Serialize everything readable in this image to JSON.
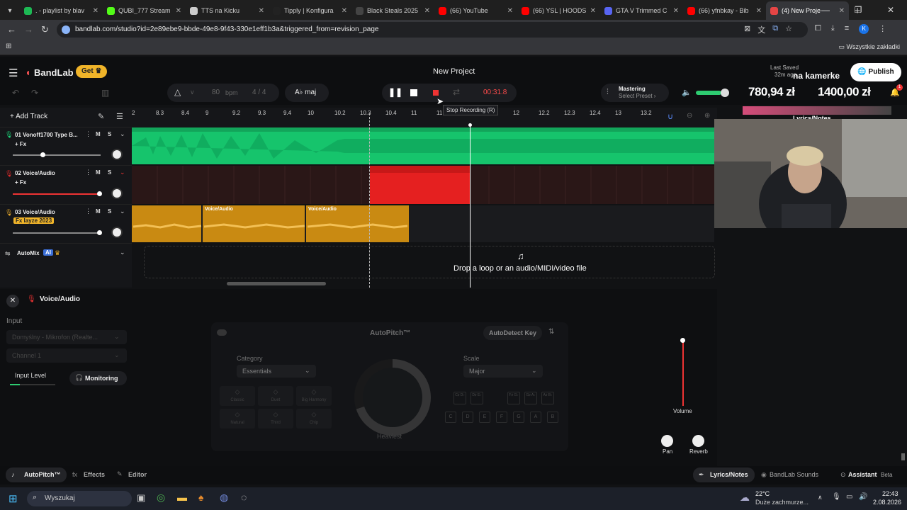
{
  "browser": {
    "tabs": [
      {
        "title": ". - playlist by blav",
        "fav": "#1db954"
      },
      {
        "title": "QUBI_777 Stream",
        "fav": "#53fc18"
      },
      {
        "title": "TTS na Kicku",
        "fav": "#cccccc"
      },
      {
        "title": "Tipply | Konfigura",
        "fav": "#222222"
      },
      {
        "title": "Black Steals 2025",
        "fav": "#444444"
      },
      {
        "title": "(66) YouTube",
        "fav": "#ff0000"
      },
      {
        "title": "(66) YSL | HOODS",
        "fav": "#ff0000"
      },
      {
        "title": "GTA V Trimmed C",
        "fav": "#5865f2"
      },
      {
        "title": "(66) yfnbkay - Bib",
        "fav": "#ff0000"
      },
      {
        "title": "(4) New Proje",
        "fav": "#e54545",
        "active": true
      }
    ],
    "url": "bandlab.com/studio?id=2e89ebe9-bbde-49e8-9f43-330e1eff1b3a&triggered_from=revision_page",
    "bookmarks_label": "Wszystkie zakładki"
  },
  "app": {
    "brand": "BandLab",
    "get_label": "Get",
    "project_title": "New Project",
    "last_saved": "Last Saved",
    "saved_ago": "32m ago",
    "publish_label": "Publish",
    "overlay_kamerke": "na kamerke",
    "overlay_money1": "780,94 zł",
    "overlay_money2": "1400,00 zł",
    "lyrics_notes_top": "Lyrics/Notes"
  },
  "toolbar": {
    "bpm_value": "80",
    "bpm_label": "bpm",
    "time_sig": "4 / 4",
    "key": "A♭ maj",
    "time": "00:31.8",
    "tooltip": "Stop Recording (R)",
    "mastering_label": "Mastering",
    "mastering_preset": "Select Preset"
  },
  "tracks_header": {
    "add_track": "Add Track"
  },
  "ruler_ticks": [
    "2",
    "8.3",
    "8.4",
    "9",
    "9.2",
    "9.3",
    "9.4",
    "10",
    "10.2",
    "10.3",
    "10.4",
    "11",
    "11",
    "",
    "12",
    "12.2",
    "12.3",
    "12.4",
    "13",
    "13.2"
  ],
  "tracks": [
    {
      "num": "01",
      "name": "Vonoff1700 Type B...",
      "fx": "+ Fx",
      "mute": "M",
      "solo": "S",
      "color": "#1dd67a"
    },
    {
      "num": "02",
      "name": "Voice/Audio",
      "fx": "+ Fx",
      "mute": "M",
      "solo": "S",
      "color": "#e02a2a"
    },
    {
      "num": "03",
      "name": "Voice/Audio",
      "fx": "Fx layze 2023",
      "mute": "M",
      "solo": "S",
      "color": "#e0a42a"
    }
  ],
  "clips": {
    "clip_label_a": "Voice/Audio",
    "clip_label_b": "Voice/Audio"
  },
  "automix": {
    "label": "AutoMix",
    "ai": "AI"
  },
  "dropzone_text": "Drop a loop or an audio/MIDI/video file",
  "panel": {
    "title": "Voice/Audio",
    "input_label": "Input",
    "input_device": "Domyślny - Mikrofon (Realte...",
    "channel": "Channel 1",
    "input_level": "Input Level",
    "monitoring": "Monitoring",
    "autopitch_title": "AutoPitch™",
    "autodetect": "AutoDetect Key",
    "category_label": "Category",
    "category_value": "Essentials",
    "scale_label": "Scale",
    "scale_value": "Major",
    "presets": [
      "Classic",
      "Duet",
      "Big Harmony",
      "Natural",
      "Third",
      "Chip"
    ],
    "knob_label": "Heaviest",
    "notes_row1": [
      "C♯ D♭",
      "D♯ E♭",
      "F♯ G♭",
      "G♯ A♭",
      "A♯ B♭"
    ],
    "notes_row2": [
      "C",
      "D",
      "E",
      "F",
      "G",
      "A",
      "B"
    ],
    "volume": "Volume",
    "pan": "Pan",
    "reverb": "Reverb"
  },
  "bottom_tabs": {
    "autopitch": "AutoPitch™",
    "effects": "Effects",
    "editor": "Editor",
    "lyrics": "Lyrics/Notes",
    "sounds": "BandLab Sounds",
    "assistant": "Assistant",
    "beta": "Beta"
  },
  "taskbar": {
    "search": "Wyszukaj",
    "temp": "22°C",
    "weather": "Duże zachmurze...",
    "clock": "22:43",
    "date": "2.08.2026"
  }
}
